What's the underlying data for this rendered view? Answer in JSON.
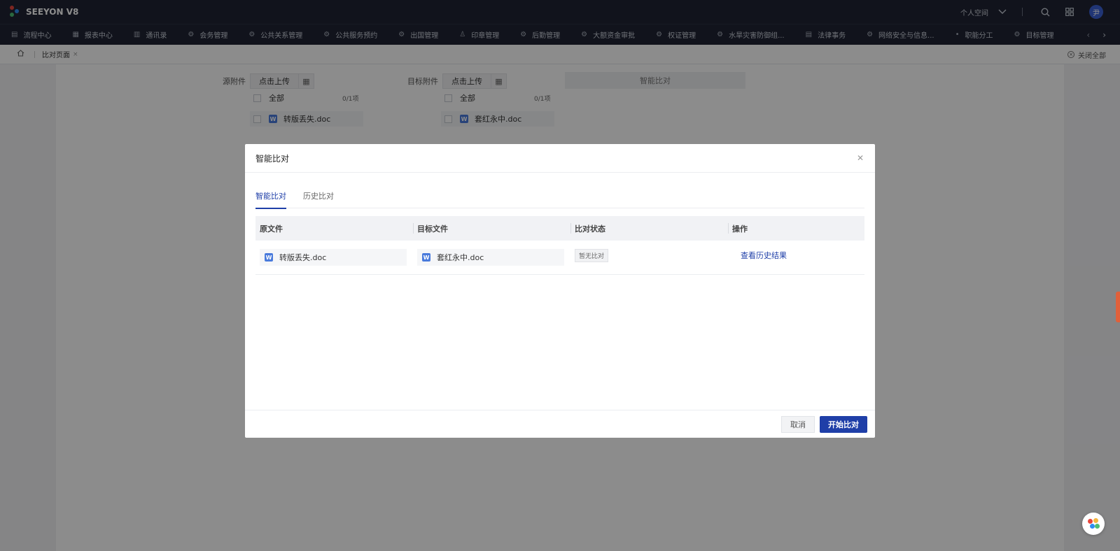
{
  "app": {
    "logo_text": "SEEYON V8",
    "personal_space": "个人空间",
    "avatar_text": "尹"
  },
  "nav": {
    "items": [
      {
        "label": "流程中心",
        "icon": "doc-icon"
      },
      {
        "label": "报表中心",
        "icon": "grid-icon"
      },
      {
        "label": "通讯录",
        "icon": "book-icon"
      },
      {
        "label": "会务管理",
        "icon": "gear-icon"
      },
      {
        "label": "公共关系管理",
        "icon": "gear-icon"
      },
      {
        "label": "公共服务预约",
        "icon": "gear-icon"
      },
      {
        "label": "出国管理",
        "icon": "gear-icon"
      },
      {
        "label": "印章管理",
        "icon": "stamp-icon"
      },
      {
        "label": "后勤管理",
        "icon": "gear-icon"
      },
      {
        "label": "大额资金审批",
        "icon": "gear-icon"
      },
      {
        "label": "权证管理",
        "icon": "gear-icon"
      },
      {
        "label": "水旱灾害防御组...",
        "icon": "gear-icon"
      },
      {
        "label": "法律事务",
        "icon": "doc-icon"
      },
      {
        "label": "网络安全与信息...",
        "icon": "gear-icon"
      },
      {
        "label": "职能分工",
        "icon": "dot-icon"
      },
      {
        "label": "目标管理",
        "icon": "gear-icon"
      }
    ]
  },
  "breadcrumb": {
    "tab": "比对页面",
    "close_all": "关闭全部"
  },
  "page": {
    "source_label": "源附件",
    "target_label": "目标附件",
    "upload_label": "点击上传",
    "smart_compare_label": "智能比对",
    "all_label": "全部",
    "count": "0/1项",
    "source_file": "转版丢失.doc",
    "target_file": "套红永中.doc"
  },
  "modal": {
    "title": "智能比对",
    "tabs": [
      "智能比对",
      "历史比对"
    ],
    "columns": [
      "原文件",
      "目标文件",
      "比对状态",
      "操作"
    ],
    "rows": [
      {
        "source": "转版丢失.doc",
        "target": "套红永中.doc",
        "status": "暂无比对",
        "action": "查看历史结果"
      }
    ],
    "cancel_label": "取消",
    "start_label": "开始比对"
  },
  "colors": {
    "header_bg": "#1f2433",
    "accent": "#1f3fa8",
    "word_icon": "#4a7bdc"
  }
}
